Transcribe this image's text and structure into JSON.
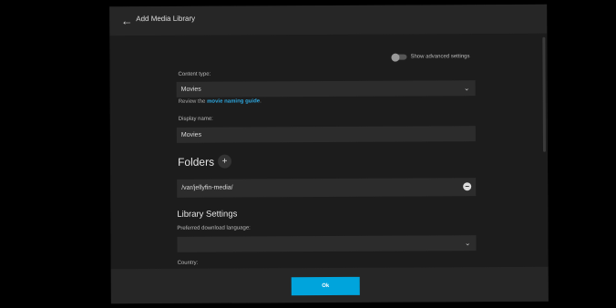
{
  "dialog": {
    "title": "Add Media Library",
    "advanced_label": "Show advanced settings",
    "content_type_label": "Content type:",
    "content_type_value": "Movies",
    "hint_prefix": "Review the",
    "hint_link": "movie naming guide",
    "hint_suffix": ".",
    "display_name_label": "Display name:",
    "display_name_value": "Movies",
    "folders_heading": "Folders",
    "add_icon": "+",
    "folder_path": "/var/jellyfin-media/",
    "library_settings_heading": "Library Settings",
    "download_language_label": "Preferred download language:",
    "download_language_value": "",
    "country_label": "Country:",
    "ok_label": "Ok"
  },
  "icons": {
    "back": "back-arrow-icon",
    "chevron": "chevron-down-icon",
    "add": "plus-icon",
    "remove": "remove-circle-icon"
  },
  "colors": {
    "accent": "#00a4dc",
    "link": "#2ea7de"
  }
}
